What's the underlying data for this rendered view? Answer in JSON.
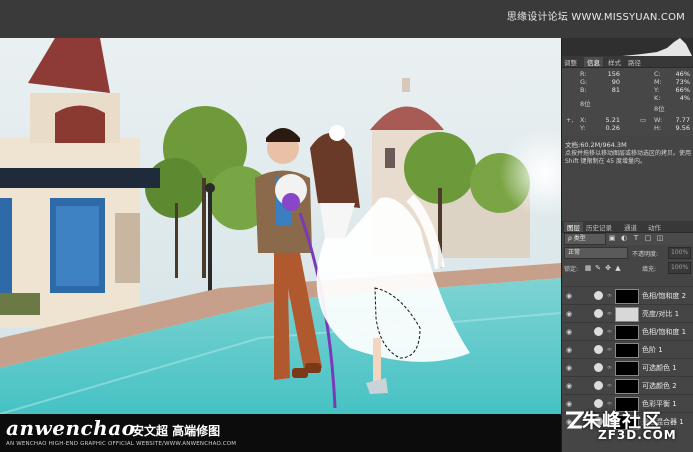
{
  "site_caption": "思缘设计论坛 WWW.MISSYUAN.COM",
  "brand": {
    "logo": "anwenchao",
    "name_cn": "安文超 高端修图",
    "subtitle": "AN WENCHAO HIGH-END GRAPHIC OFFICIAL WEBSITE/WWW.ANWENCHAO.COM"
  },
  "info_panel": {
    "tabs": [
      "调整",
      "信息",
      "样式",
      "路径"
    ],
    "active_tab": "信息",
    "rgb": {
      "R": "156",
      "G": "90",
      "B": "81"
    },
    "cmyk": {
      "C": "46%",
      "M": "73%",
      "Y": "66%",
      "K": "4%"
    },
    "bits_left": "8位",
    "bits_right": "8位",
    "xy": {
      "X": "5.21",
      "Y": "0.26"
    },
    "wh": {
      "W": "7.77",
      "H": "9.56"
    },
    "doc": "文档:60.2M/964.3M",
    "hint": "点按并拖移以移动图层或移动选区的拷贝。使用 Shift 键限制在 45 度增量内。"
  },
  "layers_panel": {
    "tabs": [
      "图层",
      "历史记录",
      "通道",
      "动作"
    ],
    "active_tab": "图层",
    "filter_kind": "ρ 类型",
    "blend_mode": "正常",
    "opacity_label": "不透明度:",
    "opacity_value": "100%",
    "lock_label": "锁定:",
    "fill_label": "填充:",
    "fill_value": "100%",
    "layers": [
      {
        "name": "色相/饱和度 2"
      },
      {
        "name": "亮度/对比 1"
      },
      {
        "name": "色相/饱和度 1"
      },
      {
        "name": "色阶 1"
      },
      {
        "name": "可选颜色 1"
      },
      {
        "name": "可选颜色 2"
      },
      {
        "name": "色彩平衡 1"
      },
      {
        "name": "通道混合器 1"
      }
    ]
  },
  "watermark": {
    "title": "朱峰社区",
    "domain": "ZF3D.COM"
  },
  "icons": [
    "eye-icon",
    "chain-icon",
    "text-tool-icon",
    "shape-icon",
    "pixel-filter-icon",
    "lock-icon",
    "brush-lock-icon",
    "move-lock-icon"
  ]
}
